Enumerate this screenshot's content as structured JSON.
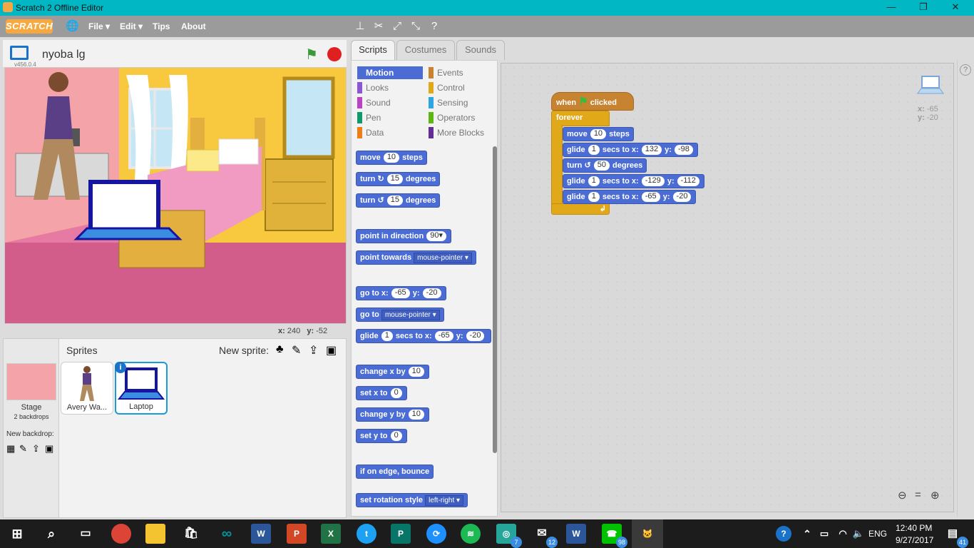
{
  "window": {
    "title": "Scratch 2 Offline Editor",
    "minimize": "—",
    "maximize": "❐",
    "close": "✕"
  },
  "menubar": {
    "logo": "SCRATCH",
    "file": "File ▾",
    "edit": "Edit ▾",
    "tips": "Tips",
    "about": "About"
  },
  "stage": {
    "project_name": "nyoba lg",
    "version": "v456.0.4",
    "mouse_x_label": "x:",
    "mouse_x": "240",
    "mouse_y_label": "y:",
    "mouse_y": "-52"
  },
  "sprites": {
    "header": "Sprites",
    "new_sprite_label": "New sprite:",
    "stage_label": "Stage",
    "stage_backdrops": "2 backdrops",
    "new_backdrop_label": "New backdrop:",
    "items": [
      {
        "name": "Avery Wa..."
      },
      {
        "name": "Laptop"
      }
    ]
  },
  "tabs": {
    "scripts": "Scripts",
    "costumes": "Costumes",
    "sounds": "Sounds"
  },
  "categories": {
    "motion": "Motion",
    "looks": "Looks",
    "sound": "Sound",
    "pen": "Pen",
    "data": "Data",
    "events": "Events",
    "control": "Control",
    "sensing": "Sensing",
    "operators": "Operators",
    "more": "More Blocks"
  },
  "palette": {
    "move_a": "move",
    "move_val": "10",
    "move_b": "steps",
    "turn_r_a": "turn",
    "turn_r_val": "15",
    "turn_r_b": "degrees",
    "turn_l_a": "turn",
    "turn_l_val": "15",
    "turn_l_b": "degrees",
    "point_dir": "point in direction",
    "point_dir_val": "90▾",
    "point_towards": "point towards",
    "point_towards_val": "mouse-pointer ▾",
    "goto_xy_a": "go to x:",
    "goto_x": "-65",
    "goto_xy_b": "y:",
    "goto_y": "-20",
    "goto": "go to",
    "goto_val": "mouse-pointer ▾",
    "glide_a": "glide",
    "glide_secs": "1",
    "glide_b": "secs to x:",
    "glide_x": "-65",
    "glide_c": "y:",
    "glide_y": "-20",
    "change_x": "change x by",
    "change_x_val": "10",
    "set_x": "set x to",
    "set_x_val": "0",
    "change_y": "change y by",
    "change_y_val": "10",
    "set_y": "set y to",
    "set_y_val": "0",
    "bounce": "if on edge, bounce",
    "rotation": "set rotation style",
    "rotation_val": "left-right ▾"
  },
  "script": {
    "hat_a": "when",
    "hat_b": "clicked",
    "forever": "forever",
    "s1_a": "move",
    "s1_val": "10",
    "s1_b": "steps",
    "s2_a": "glide",
    "s2_secs": "1",
    "s2_b": "secs to x:",
    "s2_x": "132",
    "s2_c": "y:",
    "s2_y": "-98",
    "s3_a": "turn",
    "s3_val": "50",
    "s3_b": "degrees",
    "s4_a": "glide",
    "s4_secs": "1",
    "s4_b": "secs to x:",
    "s4_x": "-129",
    "s4_c": "y:",
    "s4_y": "-112",
    "s5_a": "glide",
    "s5_secs": "1",
    "s5_b": "secs to x:",
    "s5_x": "-65",
    "s5_c": "y:",
    "s5_y": "-20"
  },
  "sprite_info": {
    "x_label": "x:",
    "x": "-65",
    "y_label": "y:",
    "y": "-20"
  },
  "taskbar": {
    "lang": "ENG",
    "time": "12:40 PM",
    "date": "9/27/2017",
    "notif_count": "41",
    "badge_instagram": "7",
    "badge_mail": "12",
    "badge_line": "98"
  }
}
